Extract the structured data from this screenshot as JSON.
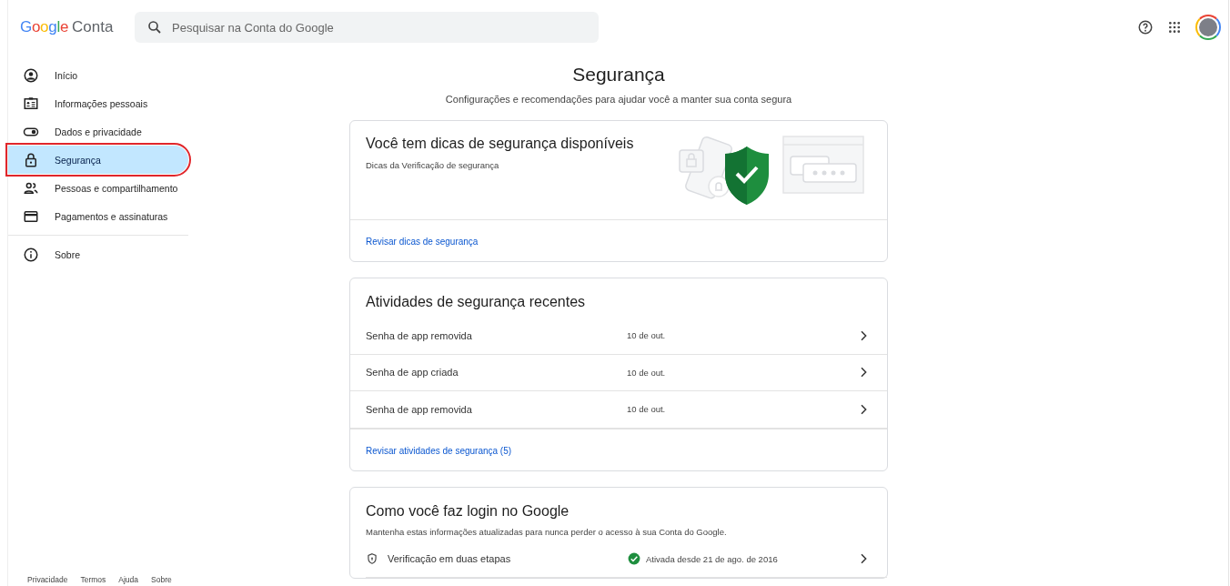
{
  "header": {
    "logo": {
      "brand": "Google",
      "product": "Conta"
    },
    "search": {
      "placeholder": "Pesquisar na Conta do Google"
    }
  },
  "sidebar": {
    "items": [
      {
        "label": "Início",
        "selected": false
      },
      {
        "label": "Informações pessoais",
        "selected": false
      },
      {
        "label": "Dados e privacidade",
        "selected": false
      },
      {
        "label": "Segurança",
        "selected": true
      },
      {
        "label": "Pessoas e compartilhamento",
        "selected": false
      },
      {
        "label": "Pagamentos e assinaturas",
        "selected": false
      }
    ],
    "secondary_items": [
      {
        "label": "Sobre",
        "selected": false
      }
    ],
    "footer_links": [
      "Privacidade",
      "Termos",
      "Ajuda",
      "Sobre"
    ]
  },
  "page": {
    "title": "Segurança",
    "subtitle": "Configurações e recomendações para ajudar você a manter sua conta segura"
  },
  "tips_card": {
    "title": "Você tem dicas de segurança disponíveis",
    "subtitle": "Dicas da Verificação de segurança",
    "link": "Revisar dicas de segurança"
  },
  "activity_card": {
    "title": "Atividades de segurança recentes",
    "rows": [
      {
        "label": "Senha de app removida",
        "date": "10 de out."
      },
      {
        "label": "Senha de app criada",
        "date": "10 de out."
      },
      {
        "label": "Senha de app removida",
        "date": "10 de out."
      }
    ],
    "link": "Revisar atividades de segurança (5)"
  },
  "signin_card": {
    "title": "Como você faz login no Google",
    "description": "Mantenha estas informações atualizadas para nunca perder o acesso à sua Conta do Google.",
    "rows": [
      {
        "label": "Verificação em duas etapas",
        "status": "Ativada desde 21 de ago. de 2016",
        "verified": true
      }
    ]
  }
}
